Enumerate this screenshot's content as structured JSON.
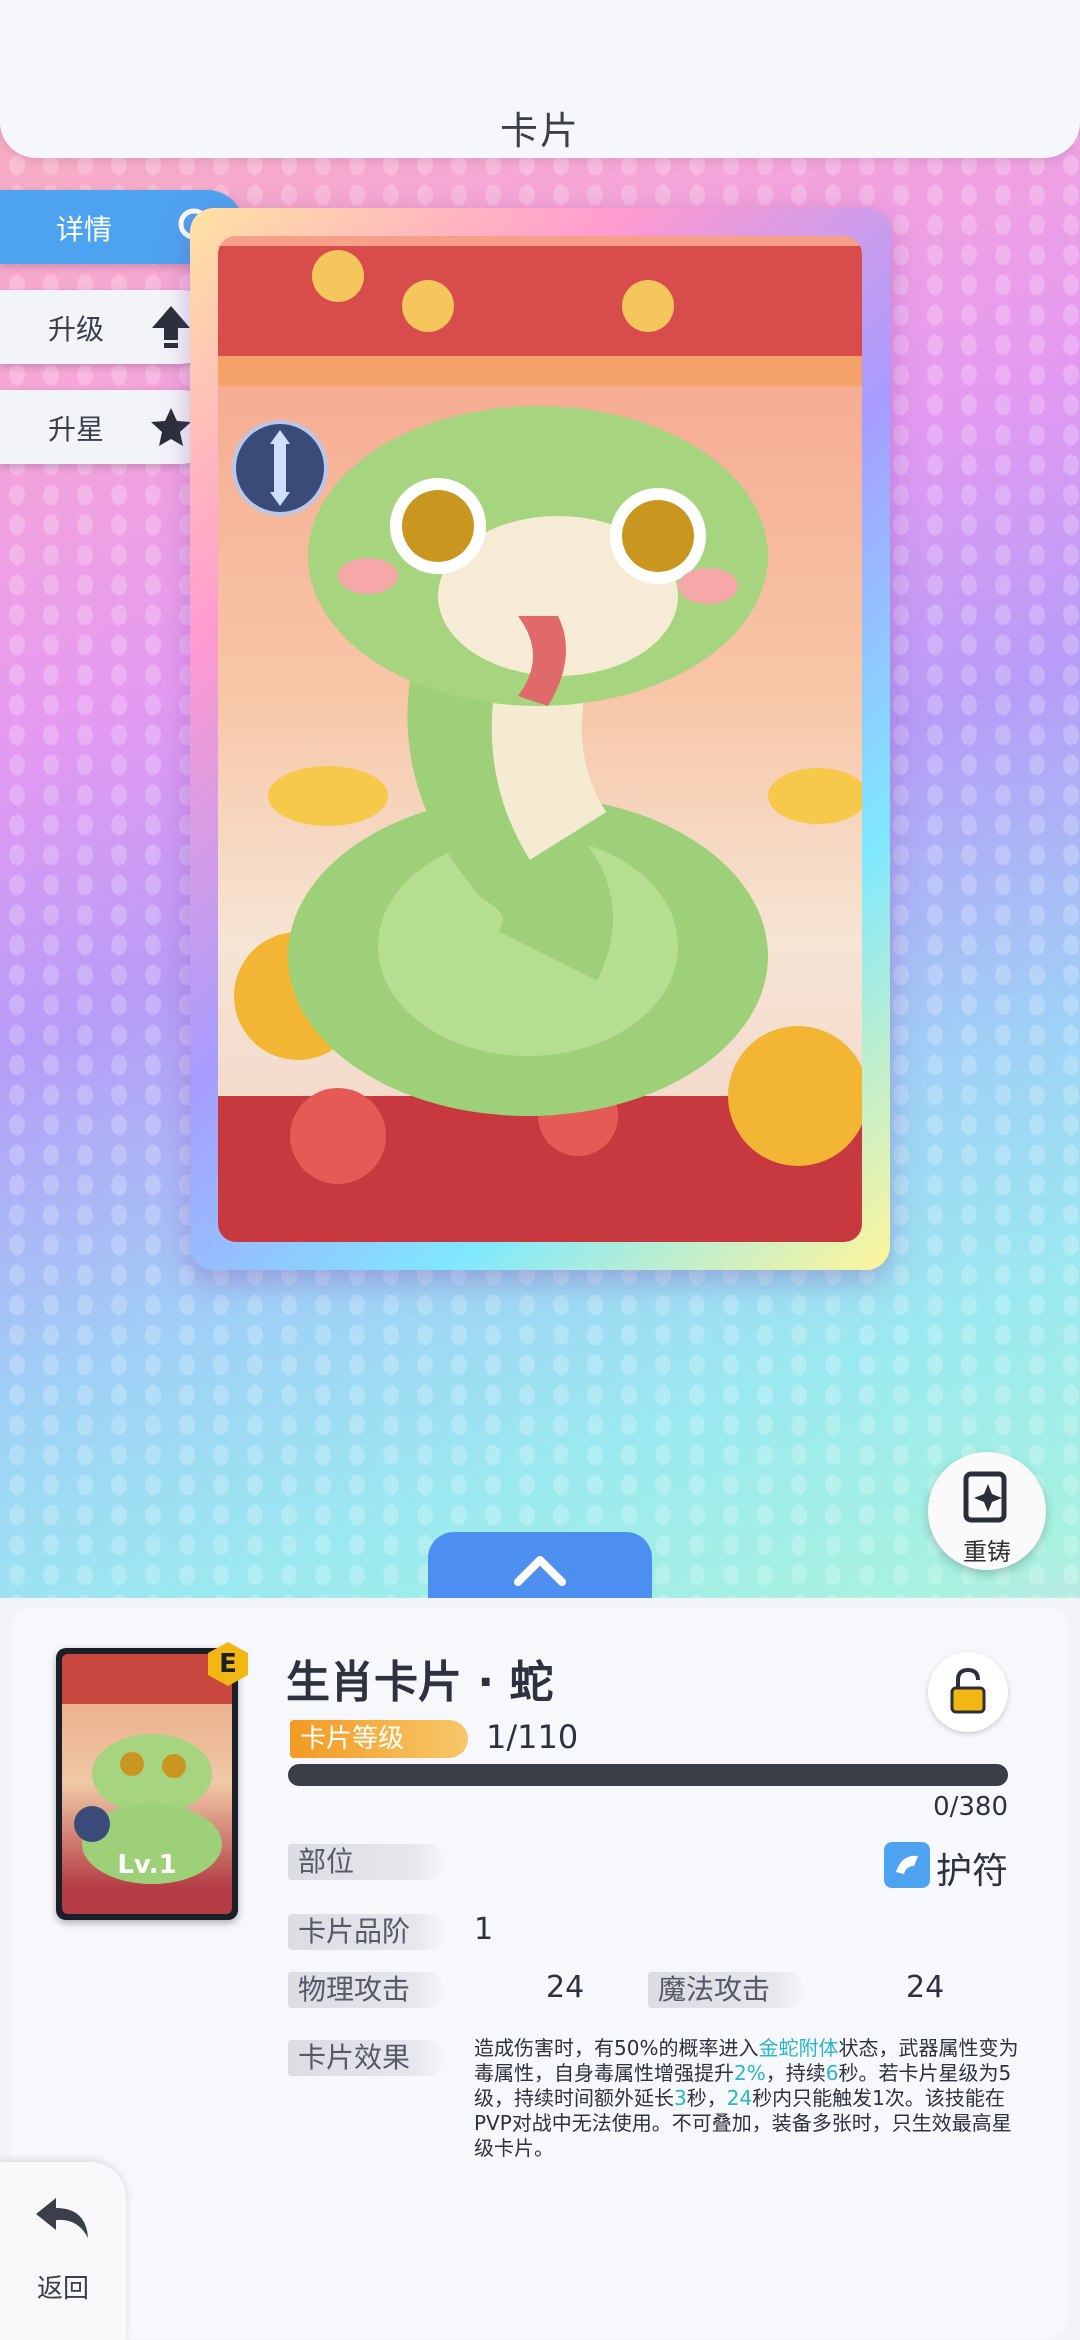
{
  "header": {
    "title": "卡片"
  },
  "side_tabs": [
    {
      "label": "详情",
      "icon": "magnifier-icon",
      "active": true
    },
    {
      "label": "升级",
      "icon": "arrow-up-icon",
      "active": false
    },
    {
      "label": "升星",
      "icon": "star-icon",
      "active": false
    }
  ],
  "rebuild_button": {
    "label": "重铸",
    "icon": "sparkle-card-icon"
  },
  "expand_button": {
    "icon": "chevron-up-icon"
  },
  "card": {
    "name": "生肖卡片 · 蛇",
    "grade": "E",
    "thumb_level": "Lv.1",
    "level_label": "卡片等级",
    "level_value": "1/110",
    "progress_text": "0/380",
    "progress": 0.0
  },
  "attributes": {
    "slot_label": "部位",
    "slot_value": "护符",
    "quality_label": "卡片品阶",
    "quality_value": "1",
    "phys_label": "物理攻击",
    "phys_value": "24",
    "magic_label": "魔法攻击",
    "magic_value": "24",
    "effect_label": "卡片效果",
    "effect_parts": {
      "p1": "造成伤害时，有50%的概率进入",
      "h1": "金蛇附体",
      "p2": "状态，武器属性变为毒属性，自身毒属性增强提升",
      "h2": "2%",
      "p3": "，持续",
      "h3": "6",
      "p4": "秒。若卡片星级为5级，持续时间额外延长",
      "h4": "3",
      "p5": "秒，",
      "h5": "24",
      "p6": "秒内只能触发1次。该技能在PVP对战中无法使用。不可叠加，装备多张时，只生效最高星级卡片。"
    }
  },
  "back_button": {
    "label": "返回",
    "icon": "back-arrow-icon"
  },
  "colors": {
    "accent_blue": "#4d8ff0",
    "badge_orange": "#f29a22",
    "highlight": "#28b6c8"
  }
}
